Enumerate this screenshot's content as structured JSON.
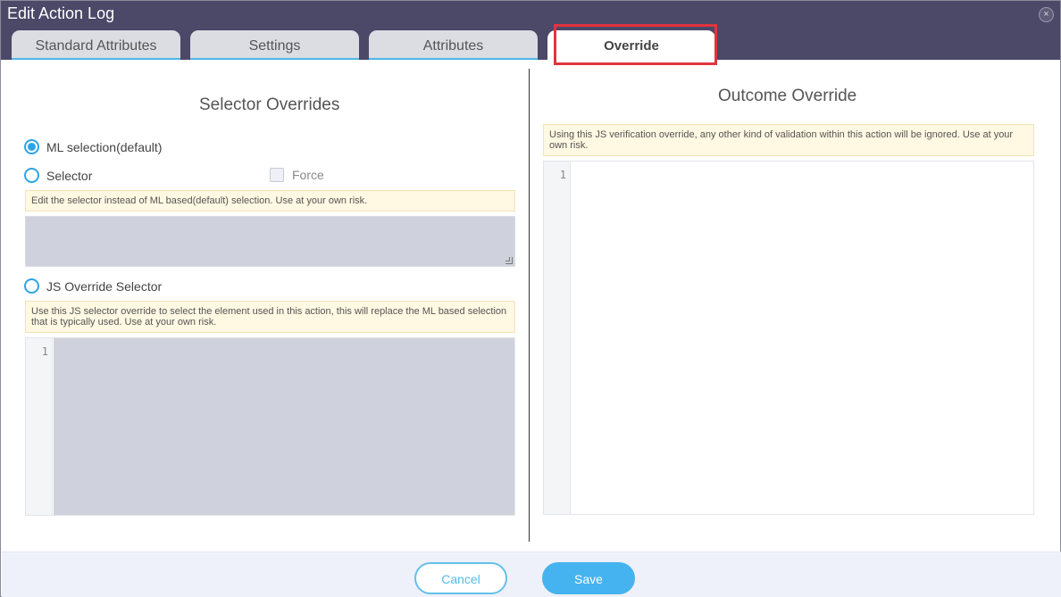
{
  "dialog": {
    "title": "Edit Action Log",
    "close_icon": "×"
  },
  "tabs": [
    {
      "label": "Standard Attributes",
      "active": false
    },
    {
      "label": "Settings",
      "active": false
    },
    {
      "label": "Attributes",
      "active": false
    },
    {
      "label": "Override",
      "active": true
    }
  ],
  "selector_overrides": {
    "title": "Selector Overrides",
    "options": {
      "ml_selection": {
        "label": "ML selection(default)",
        "checked": true
      },
      "selector": {
        "label": "Selector",
        "checked": false
      },
      "force": {
        "label": "Force",
        "checked": false
      },
      "js_override": {
        "label": "JS Override Selector",
        "checked": false
      }
    },
    "selector_note": "Edit the selector instead of ML based(default) selection. Use at your own risk.",
    "js_note": "Use this JS selector override to select the element used in this action, this will replace the ML based selection that is typically used. Use at your own risk.",
    "js_line_number": "1"
  },
  "outcome_override": {
    "title": "Outcome Override",
    "note": "Using this JS verification override, any other kind of validation within this action will be ignored. Use at your own risk.",
    "line_number": "1"
  },
  "footer": {
    "cancel_label": "Cancel",
    "save_label": "Save"
  },
  "colors": {
    "titlebar": "#4b4868",
    "accent": "#45b3ef",
    "highlight": "#e2333f"
  }
}
